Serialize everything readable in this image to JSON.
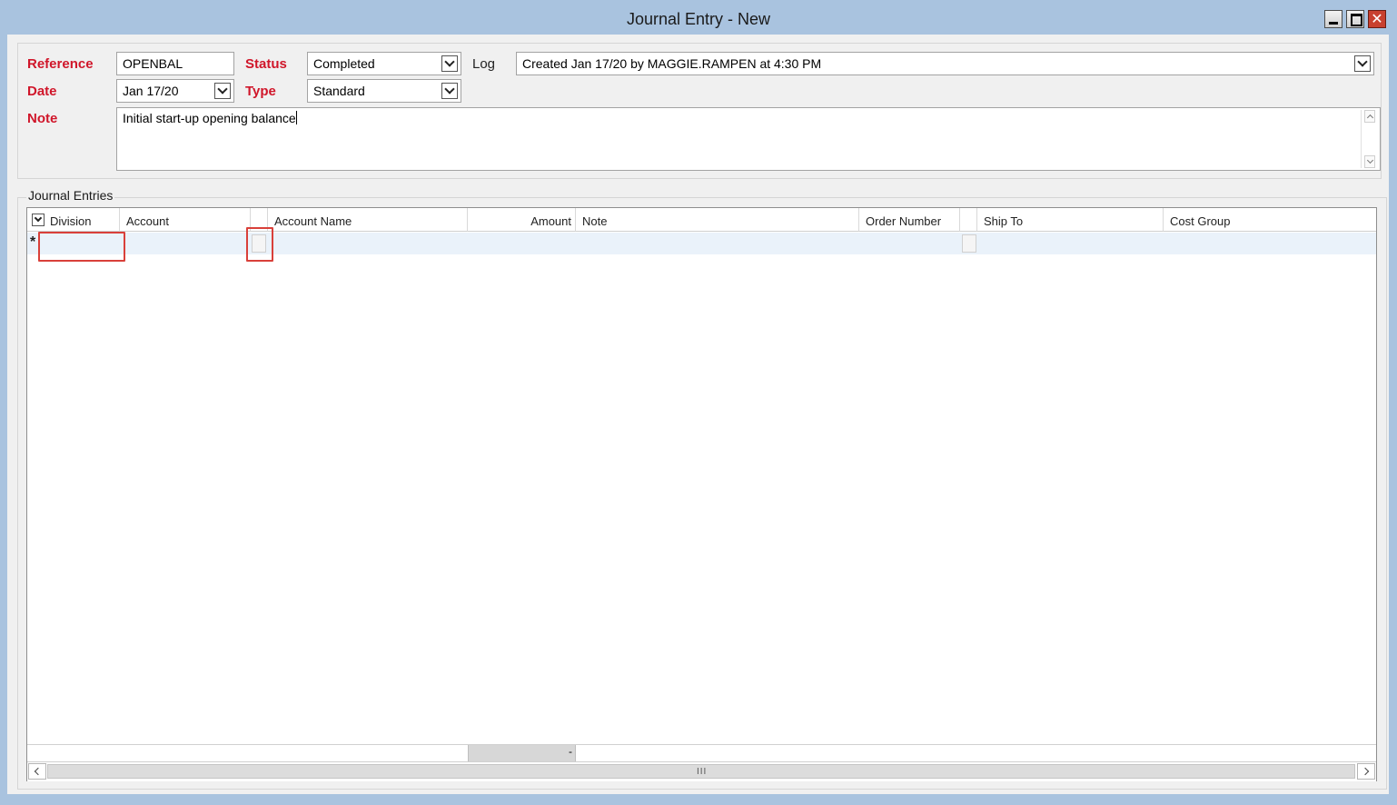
{
  "window": {
    "title": "Journal Entry - New",
    "min_glyph": "",
    "max_glyph": "",
    "close_glyph": "✕"
  },
  "header": {
    "reference_label": "Reference",
    "reference_value": "OPENBAL",
    "status_label": "Status",
    "status_value": "Completed",
    "log_label": "Log",
    "log_value": "Created Jan 17/20 by MAGGIE.RAMPEN at 4:30 PM",
    "date_label": "Date",
    "date_value": "Jan 17/20",
    "type_label": "Type",
    "type_value": "Standard",
    "note_label": "Note",
    "note_value": "Initial start-up opening balance"
  },
  "entries": {
    "group_title": "Journal Entries",
    "columns": {
      "division": "Division",
      "account": "Account",
      "account_name": "Account Name",
      "amount": "Amount",
      "note": "Note",
      "order_number": "Order Number",
      "ship_to": "Ship To",
      "cost_group": "Cost Group"
    },
    "new_row_marker": "*",
    "footer_total": "-",
    "scroll_grip": "III"
  },
  "colors": {
    "title_bar": "#a9c3df",
    "label_red": "#d0162a",
    "highlight_red": "#d9403a",
    "new_row_bg": "#eaf2fa"
  }
}
